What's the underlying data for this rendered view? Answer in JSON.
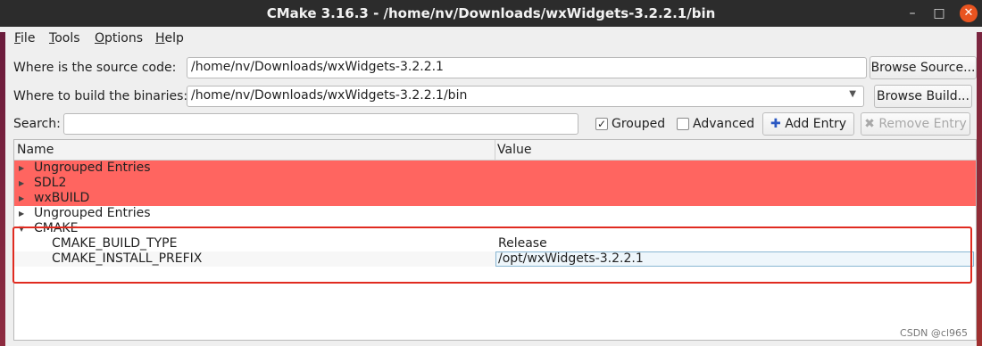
{
  "window": {
    "title": "CMake 3.16.3 - /home/nv/Downloads/wxWidgets-3.2.2.1/bin",
    "controls": {
      "minimize": "–",
      "maximize": "□",
      "close": "✕"
    }
  },
  "menu": [
    {
      "accel": "F",
      "rest": "ile"
    },
    {
      "accel": "T",
      "rest": "ools"
    },
    {
      "accel": "O",
      "rest": "ptions"
    },
    {
      "accel": "H",
      "rest": "elp"
    }
  ],
  "source": {
    "label": "Where is the source code:",
    "value": "/home/nv/Downloads/wxWidgets-3.2.2.1",
    "browse_label": "Browse Source..."
  },
  "build": {
    "label": "Where to build the binaries:",
    "value": "/home/nv/Downloads/wxWidgets-3.2.2.1/bin",
    "browse_label": "Browse Build..."
  },
  "search": {
    "label": "Search:",
    "value": ""
  },
  "options": {
    "grouped": {
      "label": "Grouped",
      "checked": true
    },
    "advanced": {
      "label": "Advanced",
      "checked": false
    }
  },
  "actions": {
    "add_entry": "Add Entry",
    "remove_entry": "Remove Entry"
  },
  "table": {
    "headers": {
      "name": "Name",
      "value": "Value"
    },
    "groups": [
      {
        "name": "Ungrouped Entries",
        "highlighted": true
      },
      {
        "name": "SDL2",
        "highlighted": true
      },
      {
        "name": "wxBUILD",
        "highlighted": true
      },
      {
        "name": "Ungrouped Entries",
        "highlighted": false
      },
      {
        "name": "CMAKE",
        "highlighted": false,
        "expanded": true
      }
    ],
    "entries": [
      {
        "name": "CMAKE_BUILD_TYPE",
        "value": "Release"
      },
      {
        "name": "CMAKE_INSTALL_PREFIX",
        "value": "/opt/wxWidgets-3.2.2.1"
      }
    ]
  },
  "colors": {
    "new_entry_highlight": "#ff6560",
    "annotation_box": "#e02b20",
    "close_button": "#e95420"
  },
  "watermark": "CSDN @cl965"
}
